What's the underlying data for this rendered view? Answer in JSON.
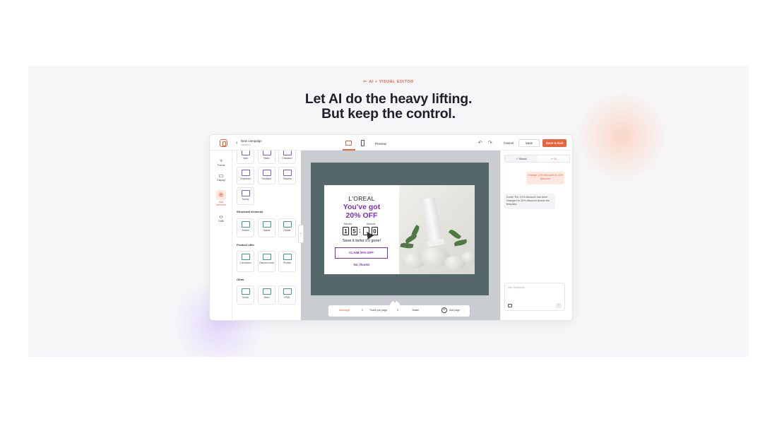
{
  "hero": {
    "badge": "AI + VISUAL EDITOR",
    "title_line1": "Let AI do the heavy lifting.",
    "title_line2": "But keep the control."
  },
  "topbar": {
    "campaign_name": "New campaign",
    "campaign_variant": "Variant 1",
    "preview_label": "Preview",
    "cancel_label": "Cancel",
    "save_label": "Save",
    "save_exit_label": "Save & Exit"
  },
  "rail": {
    "items": [
      {
        "label": "Theme",
        "icon": "brush-icon"
      },
      {
        "label": "Display",
        "icon": "monitor-icon"
      },
      {
        "label": "Add elements",
        "icon": "add-elements-icon"
      },
      {
        "label": "Code",
        "icon": "code-icon"
      }
    ]
  },
  "panel": {
    "row1": [
      "Input",
      "Radio",
      "Checkbox"
    ],
    "row2": [
      "Dropdown",
      "Feedback",
      "Textarea"
    ],
    "row3": [
      "Survey"
    ],
    "structural_heading": "Structural elements",
    "structural": [
      "Embed",
      "Spacer",
      "Divider"
    ],
    "product_heading": "Product offer",
    "product": [
      "Countdown",
      "Discount code",
      "Product"
    ],
    "other_heading": "Other",
    "other": [
      "Social",
      "Video",
      "HTML"
    ]
  },
  "popup": {
    "brand": "L'OREAL",
    "offer_line1": "You've got",
    "offer_line2": "20% OFF",
    "minutes_label": "Minutes",
    "seconds_label": "Seconds",
    "digits": [
      "1",
      "5",
      "",
      "0"
    ],
    "save_text": "Save it befor it's gone!",
    "claim_button": "CLAIM 20% OFF",
    "no_thanks": "No, thanks"
  },
  "pages": {
    "items": [
      "Mainpage",
      "Thank you page",
      "Teaser"
    ],
    "add_page": "Add page"
  },
  "ai_panel": {
    "tab_visual": "Visual",
    "tab_ai": "AI",
    "user_message": "Change 10% discount to 20% discount",
    "ai_message": "Done! The 10% discount has been changed to 20% discount across the template.",
    "ask_placeholder": "Ask OptiMonk..."
  },
  "colors": {
    "accent": "#e8643c",
    "purple": "#7b2fb8",
    "scene_bg": "#56676a"
  }
}
